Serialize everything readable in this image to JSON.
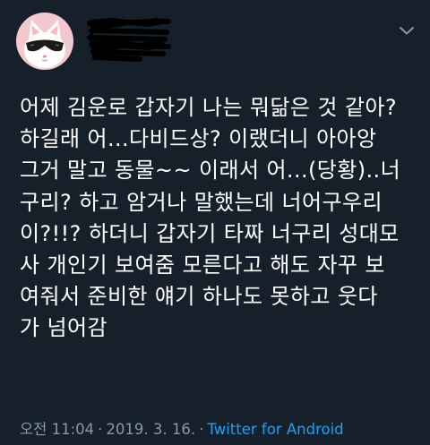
{
  "tweet": {
    "text_lines": [
      "어제 김운로 갑자기 나는 뭐닮은 것 같아?",
      "하길래 어...다비드상? 이랬더니 아아앙",
      "그거 말고 동물~~ 이래서 어...(당황)..너",
      "구리? 하고 암거나 말했는데 너어구우리",
      "이?!!? 하더니 갑자기 타짜 너구리 성대모",
      "사 개인기 보여줌 모른다고 해도 자꾸 보",
      "여줘서 준비한 얘기 하나도 못하고 웃다",
      "가 넘어감"
    ],
    "time": "오전 11:04",
    "separator": "·",
    "date": "2019. 3. 16.",
    "source": "Twitter for Android"
  },
  "icons": {
    "avatar": "white-cat-with-sunglasses-avatar",
    "redaction": "black-scribble-redaction",
    "more": "chevron-down-icon"
  },
  "colors": {
    "background": "#15202b",
    "text": "#ffffff",
    "meta": "#8899a6",
    "link": "#1da1f2",
    "avatar_bg": "#f3c9cf"
  }
}
